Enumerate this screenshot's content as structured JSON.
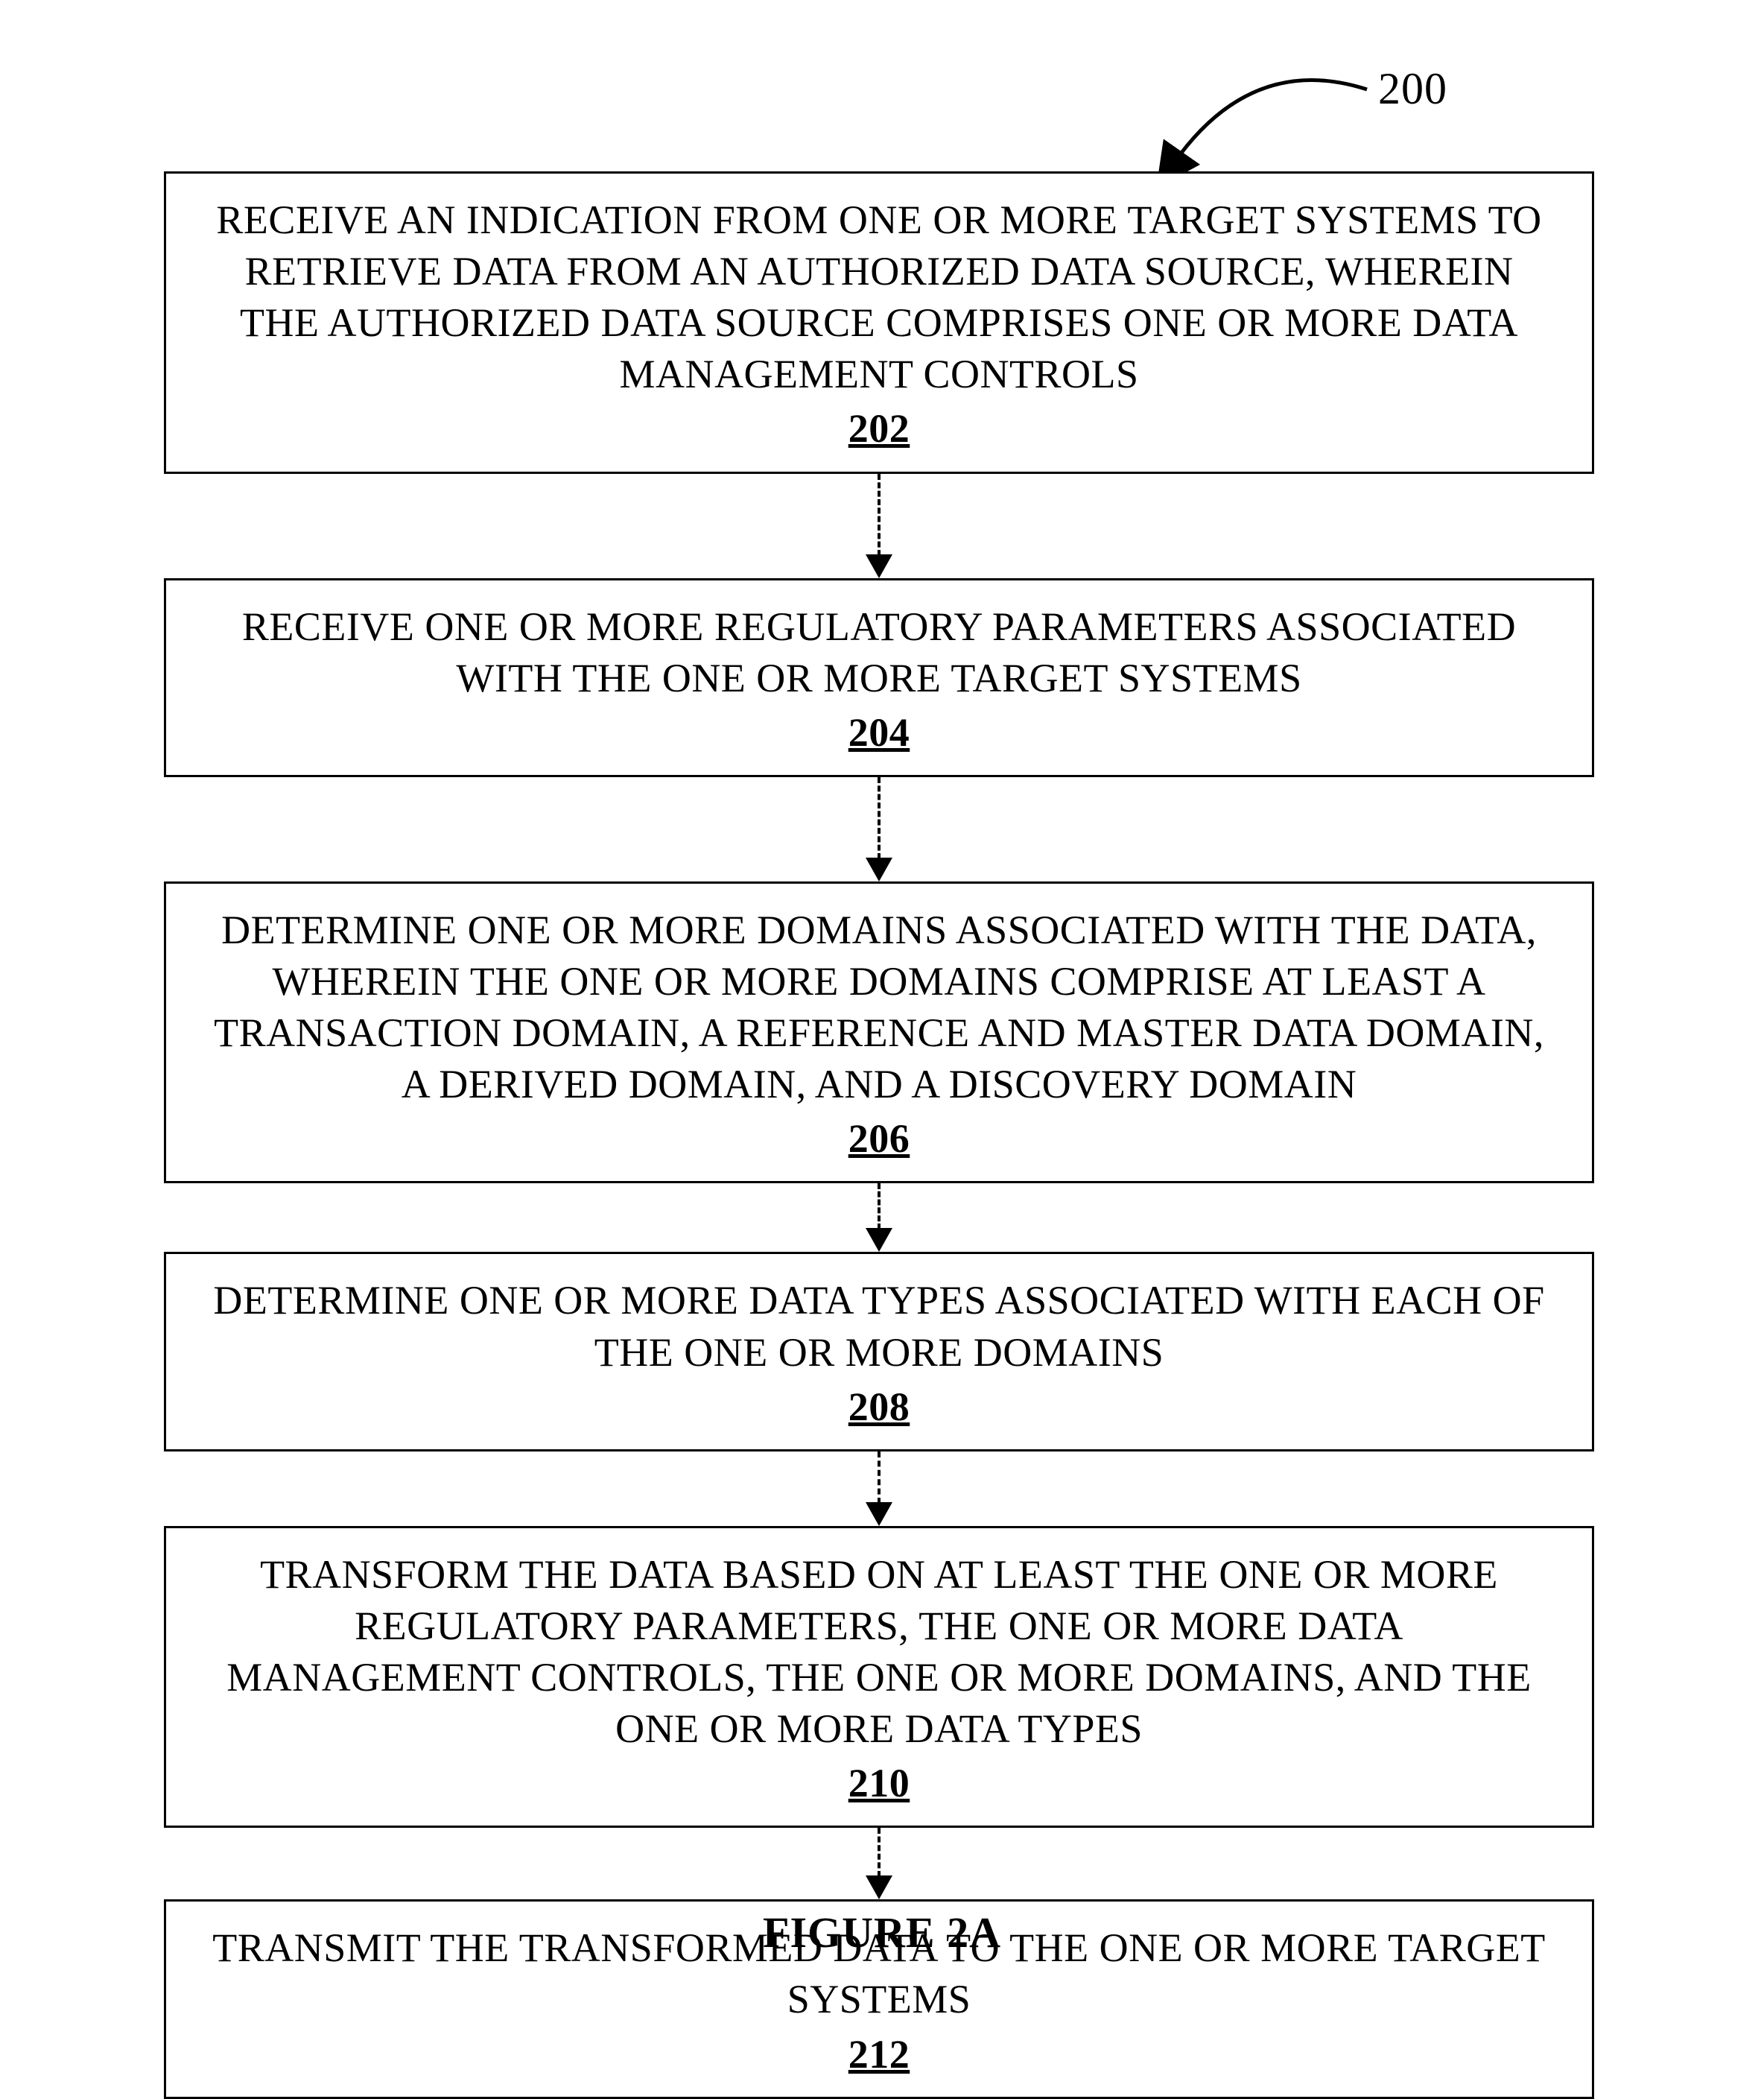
{
  "reference_number": "200",
  "figure_caption": "FIGURE 2A",
  "steps": [
    {
      "text": "RECEIVE AN INDICATION FROM ONE OR MORE TARGET SYSTEMS TO RETRIEVE DATA FROM AN AUTHORIZED DATA SOURCE, WHEREIN THE AUTHORIZED DATA SOURCE COMPRISES ONE OR MORE DATA MANAGEMENT CONTROLS",
      "num": "202"
    },
    {
      "text": "RECEIVE ONE OR MORE REGULATORY PARAMETERS ASSOCIATED WITH THE ONE OR MORE TARGET SYSTEMS",
      "num": "204"
    },
    {
      "text": "DETERMINE ONE OR MORE DOMAINS ASSOCIATED WITH THE DATA, WHEREIN THE ONE OR MORE DOMAINS COMPRISE AT LEAST A TRANSACTION DOMAIN, A REFERENCE AND MASTER DATA DOMAIN, A DERIVED DOMAIN, AND A DISCOVERY DOMAIN",
      "num": "206"
    },
    {
      "text": "DETERMINE ONE OR MORE DATA TYPES ASSOCIATED WITH EACH OF THE ONE OR MORE DOMAINS",
      "num": "208"
    },
    {
      "text": "TRANSFORM THE DATA BASED ON AT LEAST THE ONE OR MORE REGULATORY PARAMETERS, THE ONE OR MORE DATA MANAGEMENT CONTROLS, THE ONE OR MORE DOMAINS, AND THE ONE OR MORE DATA TYPES",
      "num": "210"
    },
    {
      "text": "TRANSMIT THE TRANSFORMED DATA TO THE ONE OR MORE TARGET SYSTEMS",
      "num": "212"
    }
  ]
}
